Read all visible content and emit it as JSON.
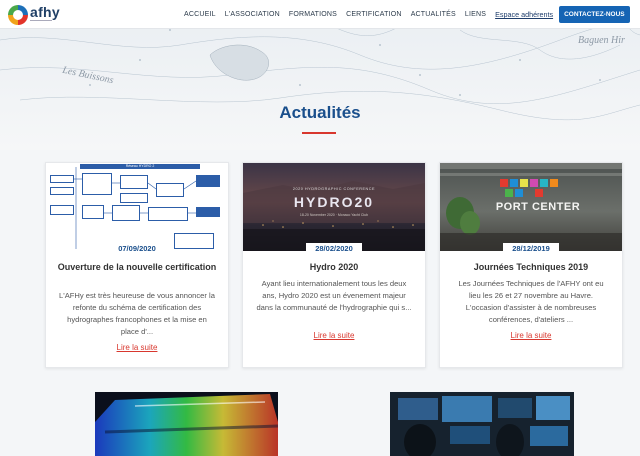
{
  "header": {
    "logo_text": "afhy",
    "nav": [
      "ACCUEIL",
      "L'ASSOCIATION",
      "FORMATIONS",
      "CERTIFICATION",
      "ACTUALITÉS",
      "LIENS"
    ],
    "espace_label": "Espace adhérents",
    "contact_label": "CONTACTEZ-NOUS",
    "linkedin_label": "in"
  },
  "map_labels": {
    "buissons": "Les Buissons",
    "baguen": "Baguen Hir"
  },
  "section": {
    "title": "Actualités"
  },
  "cards": [
    {
      "date": "07/09/2020",
      "title": "Ouverture de la nouvelle certification",
      "text": "L'AFHy est très heureuse de vous annoncer la refonte du schéma de certification des hydrographes francophones et la mise en place d'...",
      "link": "Lire la suite",
      "image_caption": "Réseau HYDRO 2"
    },
    {
      "date": "28/02/2020",
      "title": "Hydro 2020",
      "text": "Ayant lieu internationalement tous les deux ans, Hydro 2020 est un évenement majeur dans la communauté de l'hydrographie qui s...",
      "link": "Lire la suite",
      "image_top": "2020 HYDROGRAPHIC CONFERENCE",
      "image_name": "HYDRO20",
      "image_sub": "18-20 November 2020 · Monaco Yacht Club"
    },
    {
      "date": "28/12/2019",
      "title": "Journées Techniques 2019",
      "text": "Les Journées Techniques de l'AFHY ont eu lieu les 26 et 27 novembre au Havre. L'occasion d'assister à de nombreuses conférences, d'ateliers ...",
      "link": "Lire la suite",
      "image_sign": "PORT CENTER"
    }
  ],
  "colors": {
    "primary_blue": "#1a4f8c",
    "accent_red": "#d8372e",
    "button_blue": "#1564b4"
  }
}
